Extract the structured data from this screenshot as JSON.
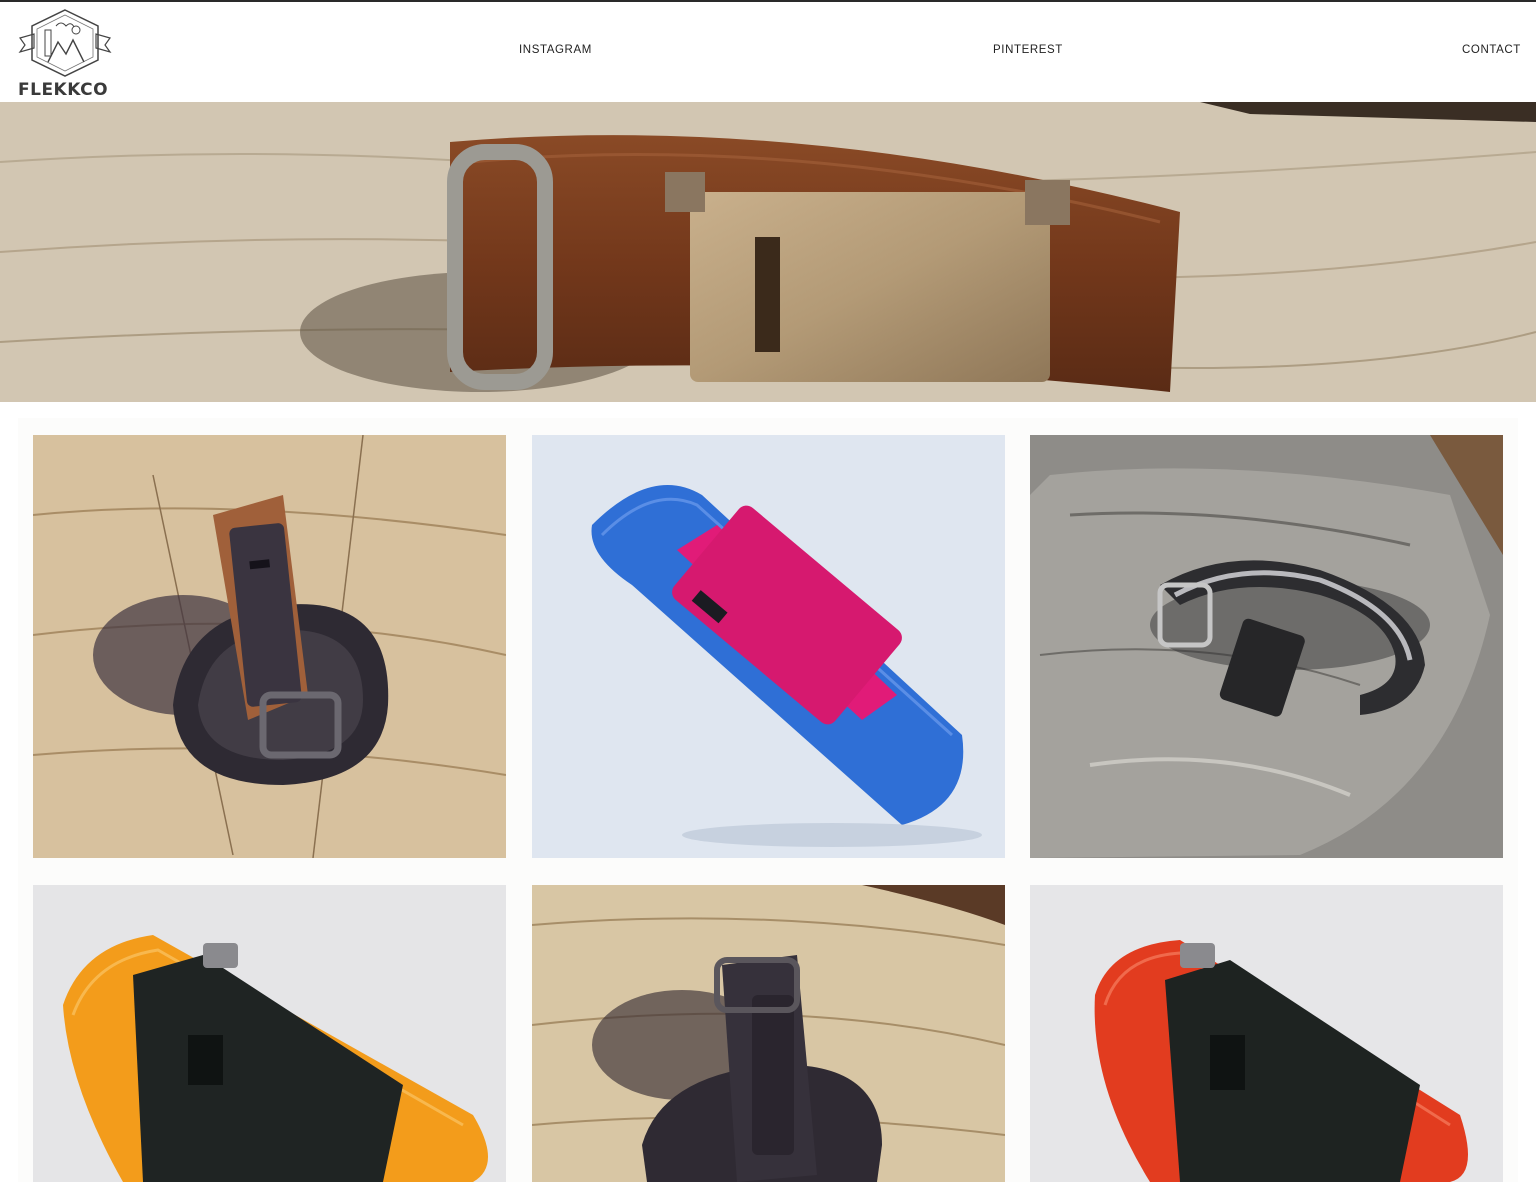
{
  "brand": {
    "name": "FLEKKCO",
    "logo_icon": "mountain-crest-icon"
  },
  "nav": {
    "instagram": "INSTAGRAM",
    "pinterest": "PINTEREST",
    "contact": "CONTACT"
  },
  "hero": {
    "subject": "brown leather band with bronze tracker case on wood"
  },
  "gallery": [
    {
      "id": "leather-brown-stump"
    },
    {
      "id": "blue-nylon-pink-case"
    },
    {
      "id": "gray-stripe-rock"
    },
    {
      "id": "orange-nylon"
    },
    {
      "id": "dark-band-stump"
    },
    {
      "id": "red-nylon"
    }
  ],
  "colors": {
    "header_bg": "#ffffff",
    "nav_text": "#222222",
    "gallery_bg": "#fcfcfb"
  }
}
